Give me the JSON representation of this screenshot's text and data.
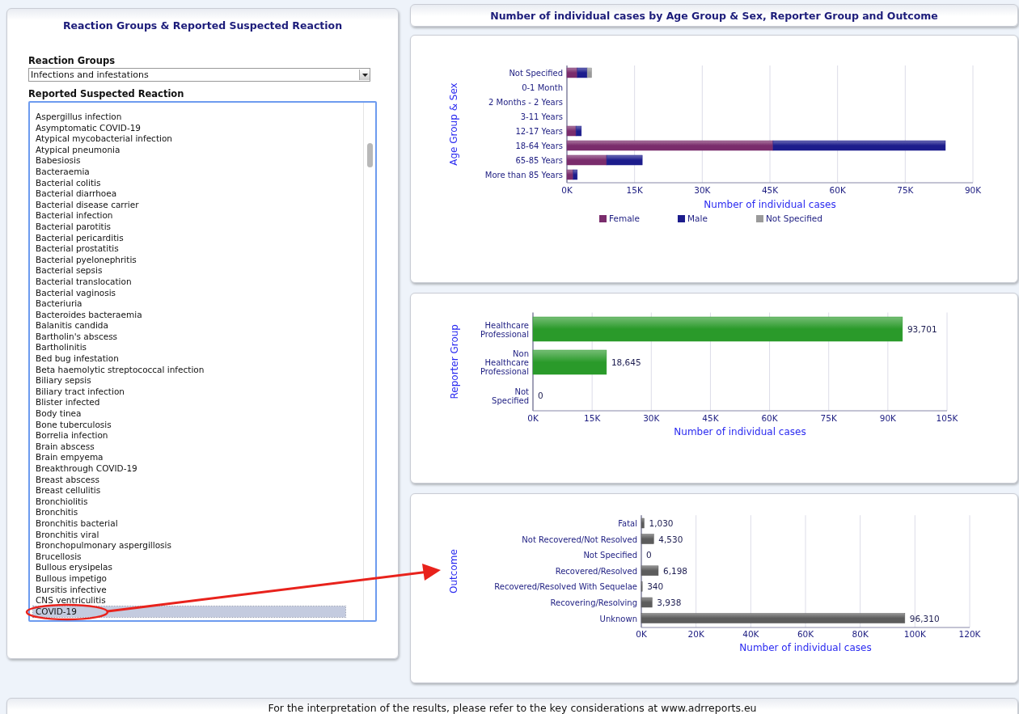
{
  "left_panel": {
    "title": "Reaction Groups & Reported Suspected Reaction",
    "reaction_groups": {
      "label": "Reaction Groups",
      "value": "Infections and infestations"
    },
    "reactions": {
      "label": "Reported Suspected Reaction",
      "items": [
        {
          "name": "Aspergillus infection",
          "selected": false
        },
        {
          "name": "Asymptomatic COVID-19",
          "selected": false
        },
        {
          "name": "Atypical mycobacterial infection",
          "selected": false
        },
        {
          "name": "Atypical pneumonia",
          "selected": false
        },
        {
          "name": "Babesiosis",
          "selected": false
        },
        {
          "name": "Bacteraemia",
          "selected": false
        },
        {
          "name": "Bacterial colitis",
          "selected": false
        },
        {
          "name": "Bacterial diarrhoea",
          "selected": false
        },
        {
          "name": "Bacterial disease carrier",
          "selected": false
        },
        {
          "name": "Bacterial infection",
          "selected": false
        },
        {
          "name": "Bacterial parotitis",
          "selected": false
        },
        {
          "name": "Bacterial pericarditis",
          "selected": false
        },
        {
          "name": "Bacterial prostatitis",
          "selected": false
        },
        {
          "name": "Bacterial pyelonephritis",
          "selected": false
        },
        {
          "name": "Bacterial sepsis",
          "selected": false
        },
        {
          "name": "Bacterial translocation",
          "selected": false
        },
        {
          "name": "Bacterial vaginosis",
          "selected": false
        },
        {
          "name": "Bacteriuria",
          "selected": false
        },
        {
          "name": "Bacteroides bacteraemia",
          "selected": false
        },
        {
          "name": "Balanitis candida",
          "selected": false
        },
        {
          "name": "Bartholin's abscess",
          "selected": false
        },
        {
          "name": "Bartholinitis",
          "selected": false
        },
        {
          "name": "Bed bug infestation",
          "selected": false
        },
        {
          "name": "Beta haemolytic streptococcal infection",
          "selected": false
        },
        {
          "name": "Biliary sepsis",
          "selected": false
        },
        {
          "name": "Biliary tract infection",
          "selected": false
        },
        {
          "name": "Blister infected",
          "selected": false
        },
        {
          "name": "Body tinea",
          "selected": false
        },
        {
          "name": "Bone tuberculosis",
          "selected": false
        },
        {
          "name": "Borrelia infection",
          "selected": false
        },
        {
          "name": "Brain abscess",
          "selected": false
        },
        {
          "name": "Brain empyema",
          "selected": false
        },
        {
          "name": "Breakthrough COVID-19",
          "selected": false
        },
        {
          "name": "Breast abscess",
          "selected": false
        },
        {
          "name": "Breast cellulitis",
          "selected": false
        },
        {
          "name": "Bronchiolitis",
          "selected": false
        },
        {
          "name": "Bronchitis",
          "selected": false
        },
        {
          "name": "Bronchitis bacterial",
          "selected": false
        },
        {
          "name": "Bronchitis viral",
          "selected": false
        },
        {
          "name": "Bronchopulmonary aspergillosis",
          "selected": false
        },
        {
          "name": "Brucellosis",
          "selected": false
        },
        {
          "name": "Bullous erysipelas",
          "selected": false
        },
        {
          "name": "Bullous impetigo",
          "selected": false
        },
        {
          "name": "Bursitis infective",
          "selected": false
        },
        {
          "name": "CNS ventriculitis",
          "selected": false
        },
        {
          "name": "COVID-19",
          "selected": true
        }
      ]
    }
  },
  "right_title": "Number of individual cases by Age Group & Sex, Reporter Group and Outcome",
  "charts": [
    {
      "chart_data": {
        "type": "bar",
        "orientation": "horizontal",
        "stacked": true,
        "grid": true,
        "legend": true,
        "xlabel": "Number of individual cases",
        "ylabel": "Age Group & Sex",
        "categories": [
          "Not Specified",
          "0-1 Month",
          "2 Months - 2 Years",
          "3-11 Years",
          "12-17 Years",
          "18-64 Years",
          "65-85 Years",
          "More than 85 Years"
        ],
        "series": [
          {
            "name": "Female",
            "color": "#7a2c6c",
            "values": [
              2300,
              0,
              0,
              0,
              2000,
              45700,
              8800,
              1400
            ]
          },
          {
            "name": "Male",
            "color": "#1c1c8c",
            "values": [
              2200,
              0,
              0,
              0,
              1200,
              38200,
              7900,
              900
            ]
          },
          {
            "name": "Not Specified",
            "color": "#9a9a9a",
            "values": [
              1000,
              0,
              0,
              0,
              0,
              0,
              0,
              0
            ]
          }
        ],
        "xlim": [
          0,
          90000
        ],
        "xticks": [
          {
            "value": 0,
            "label": "0K"
          },
          {
            "value": 15000,
            "label": "15K"
          },
          {
            "value": 30000,
            "label": "30K"
          },
          {
            "value": 45000,
            "label": "45K"
          },
          {
            "value": 60000,
            "label": "60K"
          },
          {
            "value": 75000,
            "label": "75K"
          },
          {
            "value": 90000,
            "label": "90K"
          }
        ]
      }
    },
    {
      "chart_data": {
        "type": "bar",
        "orientation": "horizontal",
        "grid": true,
        "xlabel": "Number of individual cases",
        "ylabel": "Reporter Group",
        "categories": [
          "Healthcare Professional",
          "Non Healthcare Professional",
          "Not Specified"
        ],
        "values": [
          93701,
          18645,
          0
        ],
        "value_labels": [
          "93,701",
          "18,645",
          "0"
        ],
        "xlim": [
          0,
          105000
        ],
        "xticks": [
          {
            "value": 0,
            "label": "0K"
          },
          {
            "value": 15000,
            "label": "15K"
          },
          {
            "value": 30000,
            "label": "30K"
          },
          {
            "value": 45000,
            "label": "45K"
          },
          {
            "value": 60000,
            "label": "60K"
          },
          {
            "value": 75000,
            "label": "75K"
          },
          {
            "value": 90000,
            "label": "90K"
          },
          {
            "value": 105000,
            "label": "105K"
          }
        ]
      }
    },
    {
      "chart_data": {
        "type": "bar",
        "orientation": "horizontal",
        "grid": true,
        "xlabel": "Number of individual cases",
        "ylabel": "Outcome",
        "categories": [
          "Fatal",
          "Not Recovered/Not Resolved",
          "Not Specified",
          "Recovered/Resolved",
          "Recovered/Resolved With Sequelae",
          "Recovering/Resolving",
          "Unknown"
        ],
        "values": [
          1030,
          4530,
          0,
          6198,
          340,
          3938,
          96310
        ],
        "value_labels": [
          "1,030",
          "4,530",
          "0",
          "6,198",
          "340",
          "3,938",
          "96,310"
        ],
        "xlim": [
          0,
          120000
        ],
        "xticks": [
          {
            "value": 0,
            "label": "0K"
          },
          {
            "value": 20000,
            "label": "20K"
          },
          {
            "value": 40000,
            "label": "40K"
          },
          {
            "value": 60000,
            "label": "60K"
          },
          {
            "value": 80000,
            "label": "80K"
          },
          {
            "value": 100000,
            "label": "100K"
          },
          {
            "value": 120000,
            "label": "120K"
          }
        ]
      }
    }
  ],
  "footer": "For the interpretation of the results, please refer to the key considerations at www.adrreports.eu"
}
